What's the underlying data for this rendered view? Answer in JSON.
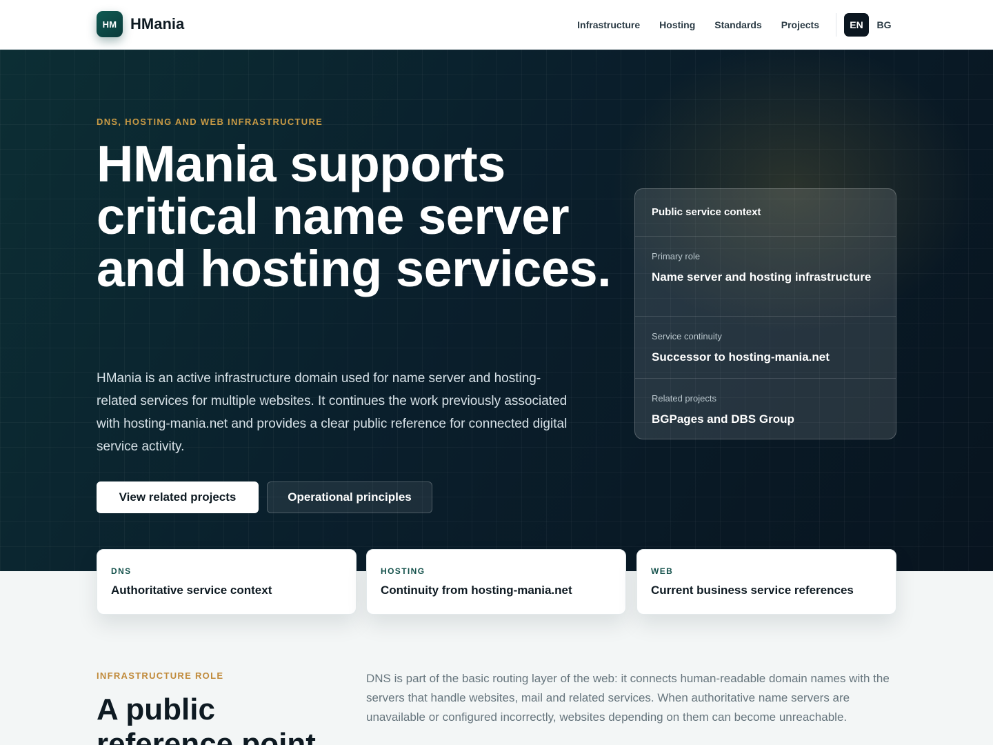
{
  "header": {
    "logo_text": "HM",
    "brand": "HMania",
    "nav": [
      "Infrastructure",
      "Hosting",
      "Standards",
      "Projects"
    ],
    "lang_active": "EN",
    "lang_other": "BG"
  },
  "hero": {
    "eyebrow": "DNS, HOSTING AND WEB INFRASTRUCTURE",
    "title": "HMania supports critical name server and hosting services.",
    "description": "HMania is an active infrastructure domain used for name server and hosting-related services for multiple websites. It continues the work previously associated with hosting-mania.net and provides a clear public reference for connected digital service activity.",
    "primary_button": "View related projects",
    "secondary_button": "Operational principles"
  },
  "context_card": {
    "title": "Public service context",
    "rows": [
      {
        "label": "Primary role",
        "value": "Name server and hosting infrastructure"
      },
      {
        "label": "Service continuity",
        "value": "Successor to hosting-mania.net"
      },
      {
        "label": "Related projects",
        "value": "BGPages and DBS Group"
      }
    ]
  },
  "features": [
    {
      "tag": "DNS",
      "text": "Authoritative service context"
    },
    {
      "tag": "HOSTING",
      "text": "Continuity from hosting-mania.net"
    },
    {
      "tag": "WEB",
      "text": "Current business service references"
    }
  ],
  "section": {
    "eyebrow": "INFRASTRUCTURE ROLE",
    "title": "A public reference point",
    "description": "DNS is part of the basic routing layer of the web: it connects human-readable domain names with the servers that handle websites, mail and related services. When authoritative name servers are unavailable or configured incorrectly, websites depending on them can become unreachable."
  },
  "colors": {
    "accent_gold": "#c89a45",
    "brand_teal": "#0f5a52",
    "hero_dark": "#0a1f2c"
  }
}
